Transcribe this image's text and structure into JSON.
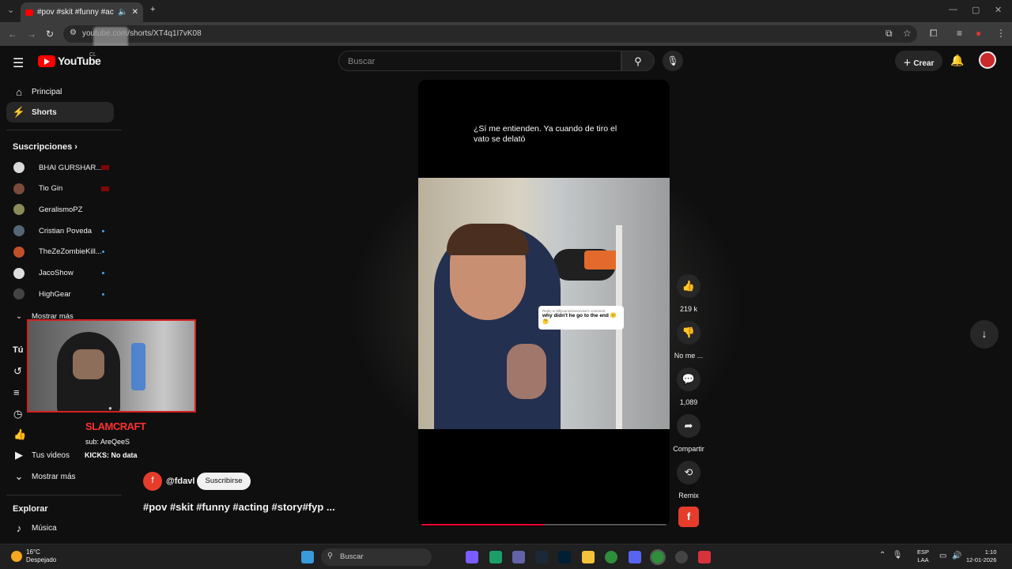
{
  "browser": {
    "tab_title": "#pov #skit #funny #acting",
    "url_prefix": "you",
    "url_suffix": "/shorts/XT4q1I7vK08"
  },
  "header": {
    "logo_text": "YouTube",
    "logo_country": "CL",
    "search_placeholder": "Buscar",
    "create_label": "Crear"
  },
  "sidebar": {
    "items": [
      {
        "label": "Principal",
        "icon": "home-icon"
      },
      {
        "label": "Shorts",
        "icon": "shorts-icon"
      }
    ],
    "subscriptions_title": "Suscripciones",
    "subscriptions": [
      {
        "name": "BHAI GURSHAR...",
        "color": "#d9d9d9",
        "status": "live"
      },
      {
        "name": "Tio Gin",
        "color": "#7a4a3a",
        "status": "live"
      },
      {
        "name": "GeralismoPZ",
        "color": "#8b8b5a",
        "status": "none"
      },
      {
        "name": "Cristian Poveda",
        "color": "#556677",
        "status": "new"
      },
      {
        "name": "TheZeZombieKill...",
        "color": "#c0502a",
        "status": "new"
      },
      {
        "name": "JacoShow",
        "color": "#dddddd",
        "status": "new"
      },
      {
        "name": "HighGear",
        "color": "#444444",
        "status": "new"
      }
    ],
    "show_more_partial": "Mostrar más",
    "you_section_title": "Tú",
    "your_videos": "Tus videos",
    "show_more": "Mostrar más",
    "explore_title": "Explorar",
    "music": "Música"
  },
  "overlay": {
    "streamer_name": "SLAMCRAFT",
    "sub_text": "sub: AreQeeS",
    "kicks": "KICKS: No data"
  },
  "short": {
    "caption": "¿Sí me entienden. Ya cuando de tiro el vato se delató",
    "reply_header": "Reply to killyourselvesrevive's comment",
    "reply_text": "why didn't he go to the end 😕🤔",
    "progress": 0.5,
    "channel": "@fdavl",
    "channel_initial": "f",
    "subscribe_label": "Suscribirse",
    "description": "#pov #skit #funny #acting #story#fyp ..."
  },
  "actions": {
    "likes": "219 k",
    "dislike": "No me ...",
    "comments": "1,089",
    "share": "Compartir",
    "remix": "Remix"
  },
  "taskbar": {
    "temperature": "16°C",
    "weather": "Despejado",
    "search_label": "Buscar",
    "lang_top": "ESP",
    "lang_bottom": "LAA",
    "time": "1:10",
    "date": "12-01-2026"
  }
}
